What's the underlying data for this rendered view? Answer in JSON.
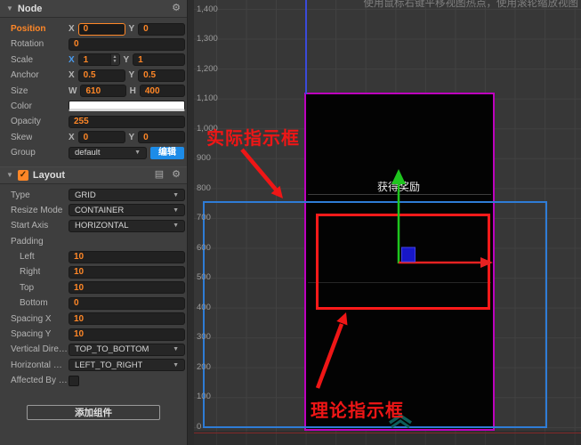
{
  "icons": {
    "gear": "⚙",
    "doc": "▤",
    "caret": "▼",
    "dropdown": "▼",
    "up": "▲",
    "down": "▼",
    "check": "✓"
  },
  "colors": {
    "accent_orange": "#ff8727",
    "axis_blue_label": "#4a9cf0",
    "edit_button_blue": "#1d8ce8",
    "canvas_border_purple": "#bd00bd",
    "frame_blue": "#2e7cd6",
    "indicator_red": "#ff1a1a",
    "annotation_red": "#ef1616",
    "gizmo_green": "#1ec41e",
    "gizmo_red": "#e62222",
    "gizmo_cube_blue": "#1717c8"
  },
  "inspector": {
    "node": {
      "title": "Node",
      "position": {
        "label": "Position",
        "x_key": "X",
        "x_value": "0",
        "y_key": "Y",
        "y_value": "0"
      },
      "rotation": {
        "label": "Rotation",
        "value": "0"
      },
      "scale": {
        "label": "Scale",
        "x_key": "X",
        "x_value": "1",
        "y_key": "Y",
        "y_value": "1"
      },
      "anchor": {
        "label": "Anchor",
        "x_key": "X",
        "x_value": "0.5",
        "y_key": "Y",
        "y_value": "0.5"
      },
      "size": {
        "label": "Size",
        "x_key": "W",
        "x_value": "610",
        "y_key": "H",
        "y_value": "400"
      },
      "color": {
        "label": "Color"
      },
      "opacity": {
        "label": "Opacity",
        "value": "255"
      },
      "skew": {
        "label": "Skew",
        "x_key": "X",
        "x_value": "0",
        "y_key": "Y",
        "y_value": "0"
      },
      "group": {
        "label": "Group",
        "value": "default",
        "edit_label": "编辑"
      }
    },
    "layout": {
      "title": "Layout",
      "type": {
        "label": "Type",
        "value": "GRID"
      },
      "resize_mode": {
        "label": "Resize Mode",
        "value": "CONTAINER"
      },
      "start_axis": {
        "label": "Start Axis",
        "value": "HORIZONTAL"
      },
      "padding": {
        "label": "Padding"
      },
      "padding_left": {
        "label": "Left",
        "value": "10"
      },
      "padding_right": {
        "label": "Right",
        "value": "10"
      },
      "padding_top": {
        "label": "Top",
        "value": "10"
      },
      "padding_bottom": {
        "label": "Bottom",
        "value": "0"
      },
      "spacing_x": {
        "label": "Spacing X",
        "value": "10"
      },
      "spacing_y": {
        "label": "Spacing Y",
        "value": "10"
      },
      "vertical_direction": {
        "label": "Vertical Direction",
        "value": "TOP_TO_BOTTOM"
      },
      "horizontal_direction": {
        "label": "Horizontal Direc...",
        "value": "LEFT_TO_RIGHT"
      },
      "affected_by_scale": {
        "label": "Affected By Scale"
      }
    },
    "add_component_label": "添加组件"
  },
  "scene": {
    "hint": "使用鼠标右键平移视图热点，使用滚轮缩放视图",
    "ruler": [
      "1,400",
      "1,300",
      "1,200",
      "1,100",
      "1,000",
      "900",
      "800",
      "700",
      "600",
      "500",
      "400",
      "300",
      "200",
      "100",
      "0"
    ],
    "canvas_text": "获得奖励",
    "annotation_actual": "实际指示框",
    "annotation_theory": "理论指示框"
  }
}
